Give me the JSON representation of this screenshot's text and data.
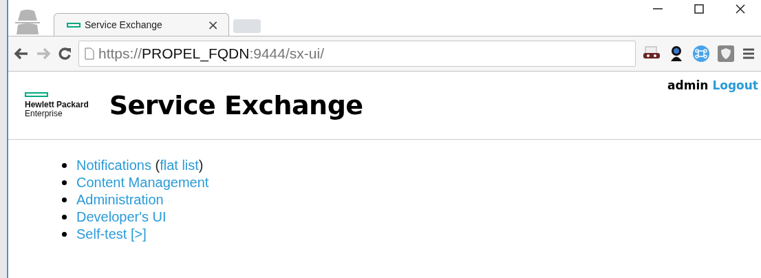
{
  "browser": {
    "tab": {
      "title": "Service Exchange",
      "close": "×",
      "selected": true
    },
    "url": {
      "scheme": "https://",
      "host": "PROPEL_FQDN",
      "rest": ":9444/sx-ui/"
    }
  },
  "header": {
    "logo": {
      "line1": "Hewlett Packard",
      "line2": "Enterprise"
    },
    "title": "Service Exchange",
    "user": "admin",
    "logout": "Logout"
  },
  "menu": [
    {
      "parts": [
        {
          "kind": "link",
          "text": "Notifications"
        },
        {
          "kind": "text",
          "text": " ("
        },
        {
          "kind": "link",
          "text": "flat list"
        },
        {
          "kind": "text",
          "text": ")"
        }
      ]
    },
    {
      "parts": [
        {
          "kind": "link",
          "text": "Content Management"
        }
      ]
    },
    {
      "parts": [
        {
          "kind": "link",
          "text": "Administration"
        }
      ]
    },
    {
      "parts": [
        {
          "kind": "link",
          "text": "Developer's UI"
        }
      ]
    },
    {
      "parts": [
        {
          "kind": "link",
          "text": "Self-test [>]"
        }
      ]
    }
  ]
}
